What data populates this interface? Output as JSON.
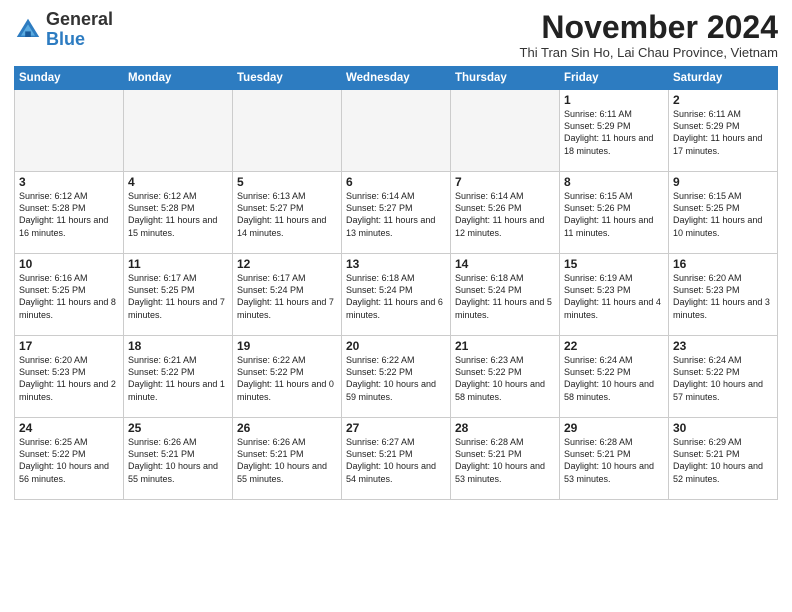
{
  "header": {
    "logo_general": "General",
    "logo_blue": "Blue",
    "month_title": "November 2024",
    "location": "Thi Tran Sin Ho, Lai Chau Province, Vietnam"
  },
  "days_of_week": [
    "Sunday",
    "Monday",
    "Tuesday",
    "Wednesday",
    "Thursday",
    "Friday",
    "Saturday"
  ],
  "weeks": [
    [
      {
        "day": "",
        "text": ""
      },
      {
        "day": "",
        "text": ""
      },
      {
        "day": "",
        "text": ""
      },
      {
        "day": "",
        "text": ""
      },
      {
        "day": "",
        "text": ""
      },
      {
        "day": "1",
        "text": "Sunrise: 6:11 AM\nSunset: 5:29 PM\nDaylight: 11 hours and 18 minutes."
      },
      {
        "day": "2",
        "text": "Sunrise: 6:11 AM\nSunset: 5:29 PM\nDaylight: 11 hours and 17 minutes."
      }
    ],
    [
      {
        "day": "3",
        "text": "Sunrise: 6:12 AM\nSunset: 5:28 PM\nDaylight: 11 hours and 16 minutes."
      },
      {
        "day": "4",
        "text": "Sunrise: 6:12 AM\nSunset: 5:28 PM\nDaylight: 11 hours and 15 minutes."
      },
      {
        "day": "5",
        "text": "Sunrise: 6:13 AM\nSunset: 5:27 PM\nDaylight: 11 hours and 14 minutes."
      },
      {
        "day": "6",
        "text": "Sunrise: 6:14 AM\nSunset: 5:27 PM\nDaylight: 11 hours and 13 minutes."
      },
      {
        "day": "7",
        "text": "Sunrise: 6:14 AM\nSunset: 5:26 PM\nDaylight: 11 hours and 12 minutes."
      },
      {
        "day": "8",
        "text": "Sunrise: 6:15 AM\nSunset: 5:26 PM\nDaylight: 11 hours and 11 minutes."
      },
      {
        "day": "9",
        "text": "Sunrise: 6:15 AM\nSunset: 5:25 PM\nDaylight: 11 hours and 10 minutes."
      }
    ],
    [
      {
        "day": "10",
        "text": "Sunrise: 6:16 AM\nSunset: 5:25 PM\nDaylight: 11 hours and 8 minutes."
      },
      {
        "day": "11",
        "text": "Sunrise: 6:17 AM\nSunset: 5:25 PM\nDaylight: 11 hours and 7 minutes."
      },
      {
        "day": "12",
        "text": "Sunrise: 6:17 AM\nSunset: 5:24 PM\nDaylight: 11 hours and 7 minutes."
      },
      {
        "day": "13",
        "text": "Sunrise: 6:18 AM\nSunset: 5:24 PM\nDaylight: 11 hours and 6 minutes."
      },
      {
        "day": "14",
        "text": "Sunrise: 6:18 AM\nSunset: 5:24 PM\nDaylight: 11 hours and 5 minutes."
      },
      {
        "day": "15",
        "text": "Sunrise: 6:19 AM\nSunset: 5:23 PM\nDaylight: 11 hours and 4 minutes."
      },
      {
        "day": "16",
        "text": "Sunrise: 6:20 AM\nSunset: 5:23 PM\nDaylight: 11 hours and 3 minutes."
      }
    ],
    [
      {
        "day": "17",
        "text": "Sunrise: 6:20 AM\nSunset: 5:23 PM\nDaylight: 11 hours and 2 minutes."
      },
      {
        "day": "18",
        "text": "Sunrise: 6:21 AM\nSunset: 5:22 PM\nDaylight: 11 hours and 1 minute."
      },
      {
        "day": "19",
        "text": "Sunrise: 6:22 AM\nSunset: 5:22 PM\nDaylight: 11 hours and 0 minutes."
      },
      {
        "day": "20",
        "text": "Sunrise: 6:22 AM\nSunset: 5:22 PM\nDaylight: 10 hours and 59 minutes."
      },
      {
        "day": "21",
        "text": "Sunrise: 6:23 AM\nSunset: 5:22 PM\nDaylight: 10 hours and 58 minutes."
      },
      {
        "day": "22",
        "text": "Sunrise: 6:24 AM\nSunset: 5:22 PM\nDaylight: 10 hours and 58 minutes."
      },
      {
        "day": "23",
        "text": "Sunrise: 6:24 AM\nSunset: 5:22 PM\nDaylight: 10 hours and 57 minutes."
      }
    ],
    [
      {
        "day": "24",
        "text": "Sunrise: 6:25 AM\nSunset: 5:22 PM\nDaylight: 10 hours and 56 minutes."
      },
      {
        "day": "25",
        "text": "Sunrise: 6:26 AM\nSunset: 5:21 PM\nDaylight: 10 hours and 55 minutes."
      },
      {
        "day": "26",
        "text": "Sunrise: 6:26 AM\nSunset: 5:21 PM\nDaylight: 10 hours and 55 minutes."
      },
      {
        "day": "27",
        "text": "Sunrise: 6:27 AM\nSunset: 5:21 PM\nDaylight: 10 hours and 54 minutes."
      },
      {
        "day": "28",
        "text": "Sunrise: 6:28 AM\nSunset: 5:21 PM\nDaylight: 10 hours and 53 minutes."
      },
      {
        "day": "29",
        "text": "Sunrise: 6:28 AM\nSunset: 5:21 PM\nDaylight: 10 hours and 53 minutes."
      },
      {
        "day": "30",
        "text": "Sunrise: 6:29 AM\nSunset: 5:21 PM\nDaylight: 10 hours and 52 minutes."
      }
    ]
  ]
}
